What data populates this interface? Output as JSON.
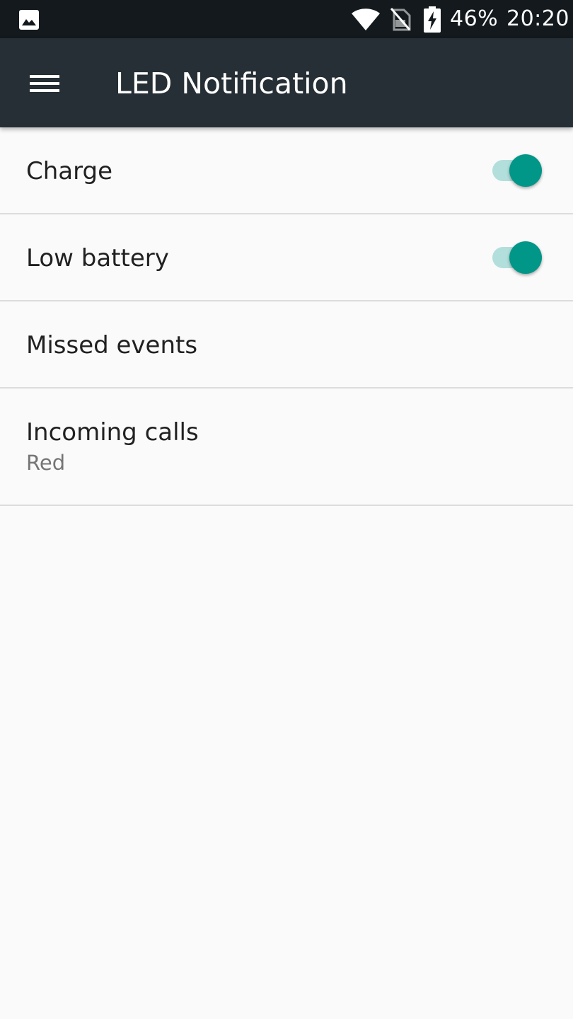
{
  "status_bar": {
    "battery_percent": "46%",
    "time": "20:20",
    "icons": [
      "gallery-icon",
      "wifi-icon",
      "no-sim-icon",
      "battery-charging-icon"
    ]
  },
  "app_bar": {
    "title": "LED Notification",
    "menu_icon": "hamburger-menu-icon"
  },
  "settings": [
    {
      "label": "Charge",
      "switch_on": true
    },
    {
      "label": "Low battery",
      "switch_on": true
    },
    {
      "label": "Missed events"
    },
    {
      "label": "Incoming calls",
      "summary": "Red"
    }
  ],
  "colors": {
    "status_bar": "#13191c",
    "app_bar": "#262f36",
    "accent": "#009688",
    "accent_track": "#b2dfdb",
    "background": "#fafafa",
    "divider": "#dcdcdc"
  }
}
